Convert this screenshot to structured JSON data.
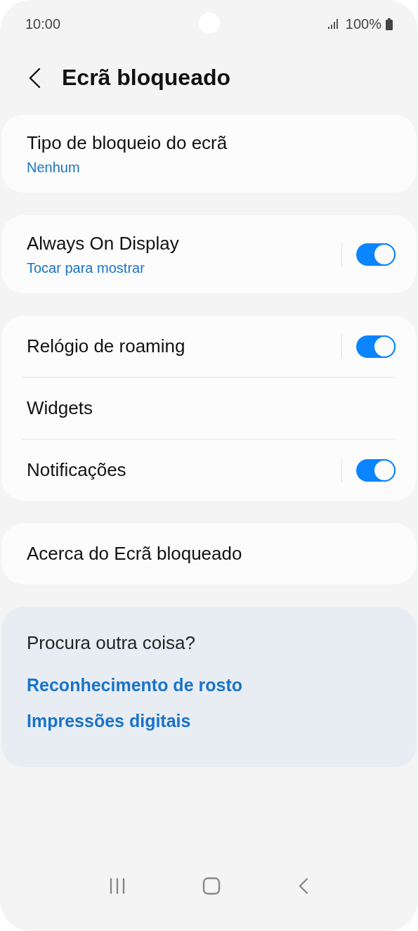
{
  "status_bar": {
    "time": "10:00",
    "battery": "100%"
  },
  "header": {
    "title": "Ecrã bloqueado"
  },
  "groups": [
    {
      "items": [
        {
          "title": "Tipo de bloqueio do ecrã",
          "subtitle": "Nenhum"
        }
      ]
    },
    {
      "items": [
        {
          "title": "Always On Display",
          "subtitle": "Tocar para mostrar",
          "switch_on": true
        }
      ]
    },
    {
      "items": [
        {
          "title": "Relógio de roaming",
          "switch_on": true
        },
        {
          "title": "Widgets"
        },
        {
          "title": "Notificações",
          "switch_on": true
        }
      ]
    },
    {
      "items": [
        {
          "title": "Acerca do Ecrã bloqueado"
        }
      ]
    }
  ],
  "related": {
    "title": "Procura outra coisa?",
    "links": [
      "Reconhecimento de rosto",
      "Impressões digitais"
    ]
  }
}
